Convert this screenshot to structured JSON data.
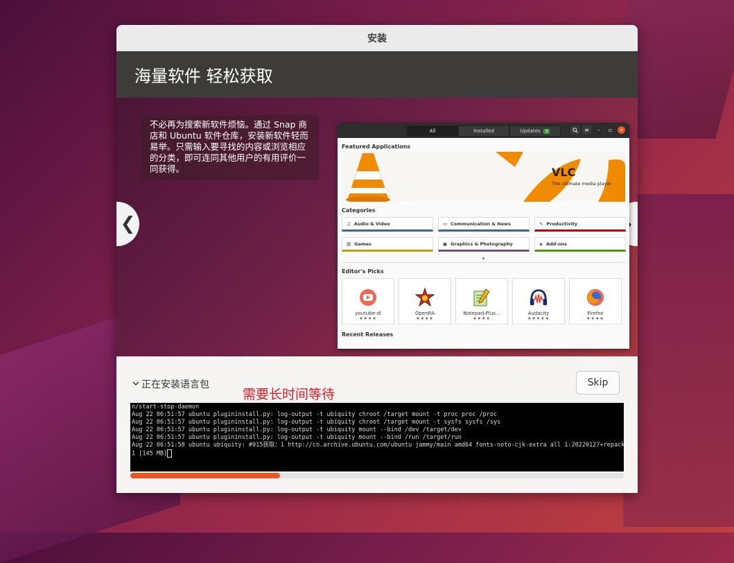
{
  "window": {
    "title": "安装"
  },
  "header": {
    "title": "海量软件 轻松获取"
  },
  "slide": {
    "description": "不必再为搜索新软件烦恼。通过 Snap 商店和 Ubuntu 软件仓库，安装新软件轻而易举。只需输入要寻找的内容或浏览相应的分类，即可连同其他用户的有用评价一同获得。",
    "prev_icon": "❮",
    "next_icon": "❯"
  },
  "software_app": {
    "tabs": [
      "All",
      "Installed",
      "Updates"
    ],
    "updates_count": "3",
    "featured_title": "Featured Applications",
    "vlc_name": "VLC",
    "vlc_tagline": "The ultimate media player",
    "categories_title": "Categories",
    "categories": [
      {
        "label": "Audio & Video",
        "icon": "♫",
        "color": "#3465a4"
      },
      {
        "label": "Communication & News",
        "icon": "▭",
        "color": "#3465a4"
      },
      {
        "label": "Productivity",
        "icon": "✎",
        "color": "#cc0000"
      },
      {
        "label": "Games",
        "icon": "▤",
        "color": "#c4a000"
      },
      {
        "label": "Graphics & Photography",
        "icon": "▣",
        "color": "#75507b"
      },
      {
        "label": "Add-ons",
        "icon": "◈",
        "color": "#4e9a06"
      }
    ],
    "editors_title": "Editor's Picks",
    "picks": [
      {
        "name": "youtube-dl",
        "stars": "★★★★"
      },
      {
        "name": "OpenRA",
        "stars": "★★★★"
      },
      {
        "name": "Notepad-Plus...",
        "stars": "★★★★"
      },
      {
        "name": "Audacity",
        "stars": "★★★★★"
      },
      {
        "name": "Firefox",
        "stars": "★★★★"
      }
    ],
    "recent_title": "Recent Releases"
  },
  "install": {
    "status_label": "正在安装语言包",
    "wait_note": "需要长时间等待",
    "skip_label": "Skip",
    "log": "n/start-stop-daemon\nAug 22 06:51:57 ubuntu plugininstall.py: log-output -t ubiquity chroot /target mount -t proc proc /proc\nAug 22 06:51:57 ubuntu plugininstall.py: log-output -t ubiquity chroot /target mount -t sysfs sysfs /sys\nAug 22 06:51:57 ubuntu plugininstall.py: log-output -t ubiquity mount --bind /dev /target/dev\nAug 22 06:51:57 ubuntu plugininstall.py: log-output -t ubiquity mount --bind /run /target/run\nAug 22 06:51:58 ubuntu ubiquity: #015获取：1 http://cn.archive.ubuntu.com/ubuntu jammy/main amd64 fonts-noto-cjk-extra all 1:20220127+repack1-\n1 [145 MB]",
    "progress_fraction": 0.304
  },
  "colors": {
    "accent": "#e95420",
    "header_bg": "#3d3c3a",
    "warning_text": "#e01b24"
  }
}
